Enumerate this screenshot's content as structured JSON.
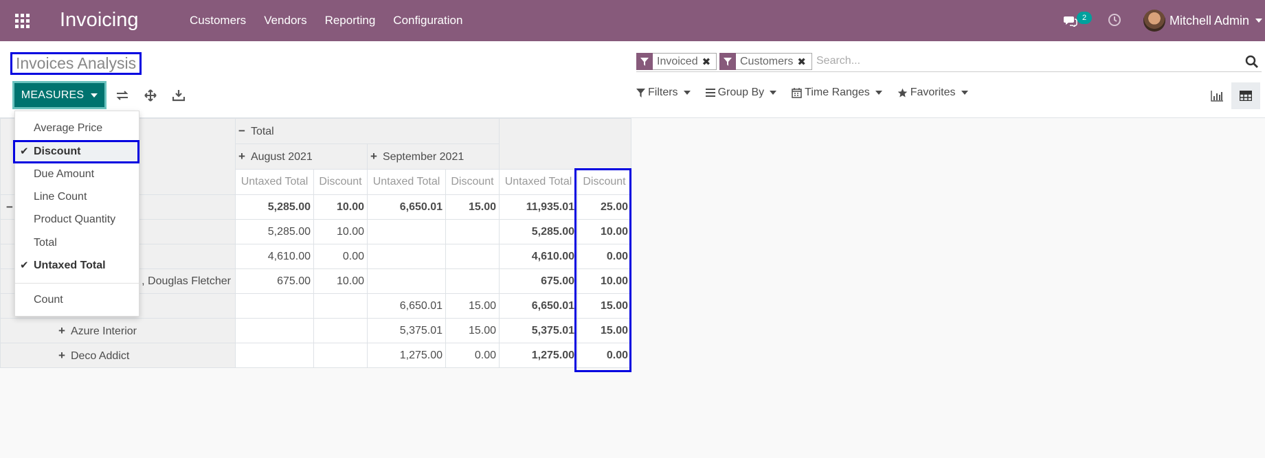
{
  "navbar": {
    "brand": "Invoicing",
    "menu": [
      "Customers",
      "Vendors",
      "Reporting",
      "Configuration"
    ],
    "chat_count": "2",
    "user_name": "Mitchell Admin"
  },
  "control": {
    "title": "Invoices Analysis",
    "measures_label": "MEASURES",
    "facets": [
      {
        "label": "Invoiced"
      },
      {
        "label": "Customers"
      }
    ],
    "search_placeholder": "Search...",
    "filters_label": "Filters",
    "groupby_label": "Group By",
    "timeranges_label": "Time Ranges",
    "favorites_label": "Favorites"
  },
  "measures_menu": {
    "items": [
      {
        "label": "Average Price",
        "checked": false
      },
      {
        "label": "Discount",
        "checked": true
      },
      {
        "label": "Due Amount",
        "checked": false
      },
      {
        "label": "Line Count",
        "checked": false
      },
      {
        "label": "Product Quantity",
        "checked": false
      },
      {
        "label": "Total",
        "checked": false
      },
      {
        "label": "Untaxed Total",
        "checked": true
      }
    ],
    "count_label": "Count"
  },
  "pivot": {
    "col_total": "Total",
    "col_groups": [
      "August 2021",
      "September 2021"
    ],
    "measures": [
      "Untaxed Total",
      "Discount",
      "Untaxed Total",
      "Discount",
      "Untaxed Total",
      "Discount"
    ],
    "rows": [
      {
        "label": "",
        "values": [
          "5,285.00",
          "10.00",
          "6,650.01",
          "15.00",
          "11,935.01",
          "25.00"
        ],
        "bold_all": true
      },
      {
        "label": "",
        "values": [
          "5,285.00",
          "10.00",
          "",
          "",
          "5,285.00",
          "10.00"
        ]
      },
      {
        "label": "",
        "values": [
          "4,610.00",
          "0.00",
          "",
          "",
          "4,610.00",
          "0.00"
        ]
      },
      {
        "label": ", Douglas Fletcher",
        "values": [
          "675.00",
          "10.00",
          "",
          "",
          "675.00",
          "10.00"
        ]
      },
      {
        "label": "",
        "values": [
          "",
          "",
          "6,650.01",
          "15.00",
          "6,650.01",
          "15.00"
        ]
      },
      {
        "label": "Azure Interior",
        "values": [
          "",
          "",
          "5,375.01",
          "15.00",
          "5,375.01",
          "15.00"
        ]
      },
      {
        "label": "Deco Addict",
        "values": [
          "",
          "",
          "1,275.00",
          "0.00",
          "1,275.00",
          "0.00"
        ]
      }
    ]
  }
}
